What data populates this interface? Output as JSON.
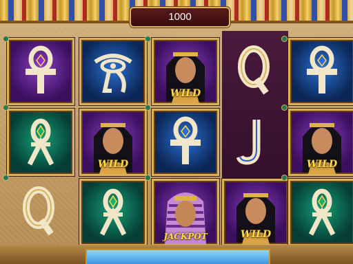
{
  "balance": "1000",
  "labels": {
    "wild": "WILD",
    "jackpot": "JACKPOT"
  },
  "grid": [
    [
      "ankh-purple",
      "eye-of-horus",
      "cleopatra-wild",
      "q-royal",
      "ankh-blue"
    ],
    [
      "ankh-green",
      "cleopatra-wild",
      "ankh-blue",
      "j-royal",
      "cleopatra-wild"
    ],
    [
      "q-royal",
      "ankh-green",
      "pharaoh-jackpot",
      "cleopatra-wild",
      "ankh-green"
    ]
  ],
  "colors": {
    "frame_gold": "#d9b25a",
    "label_gold": "#ffd84a",
    "balance_bg": "#3a0c0c"
  }
}
